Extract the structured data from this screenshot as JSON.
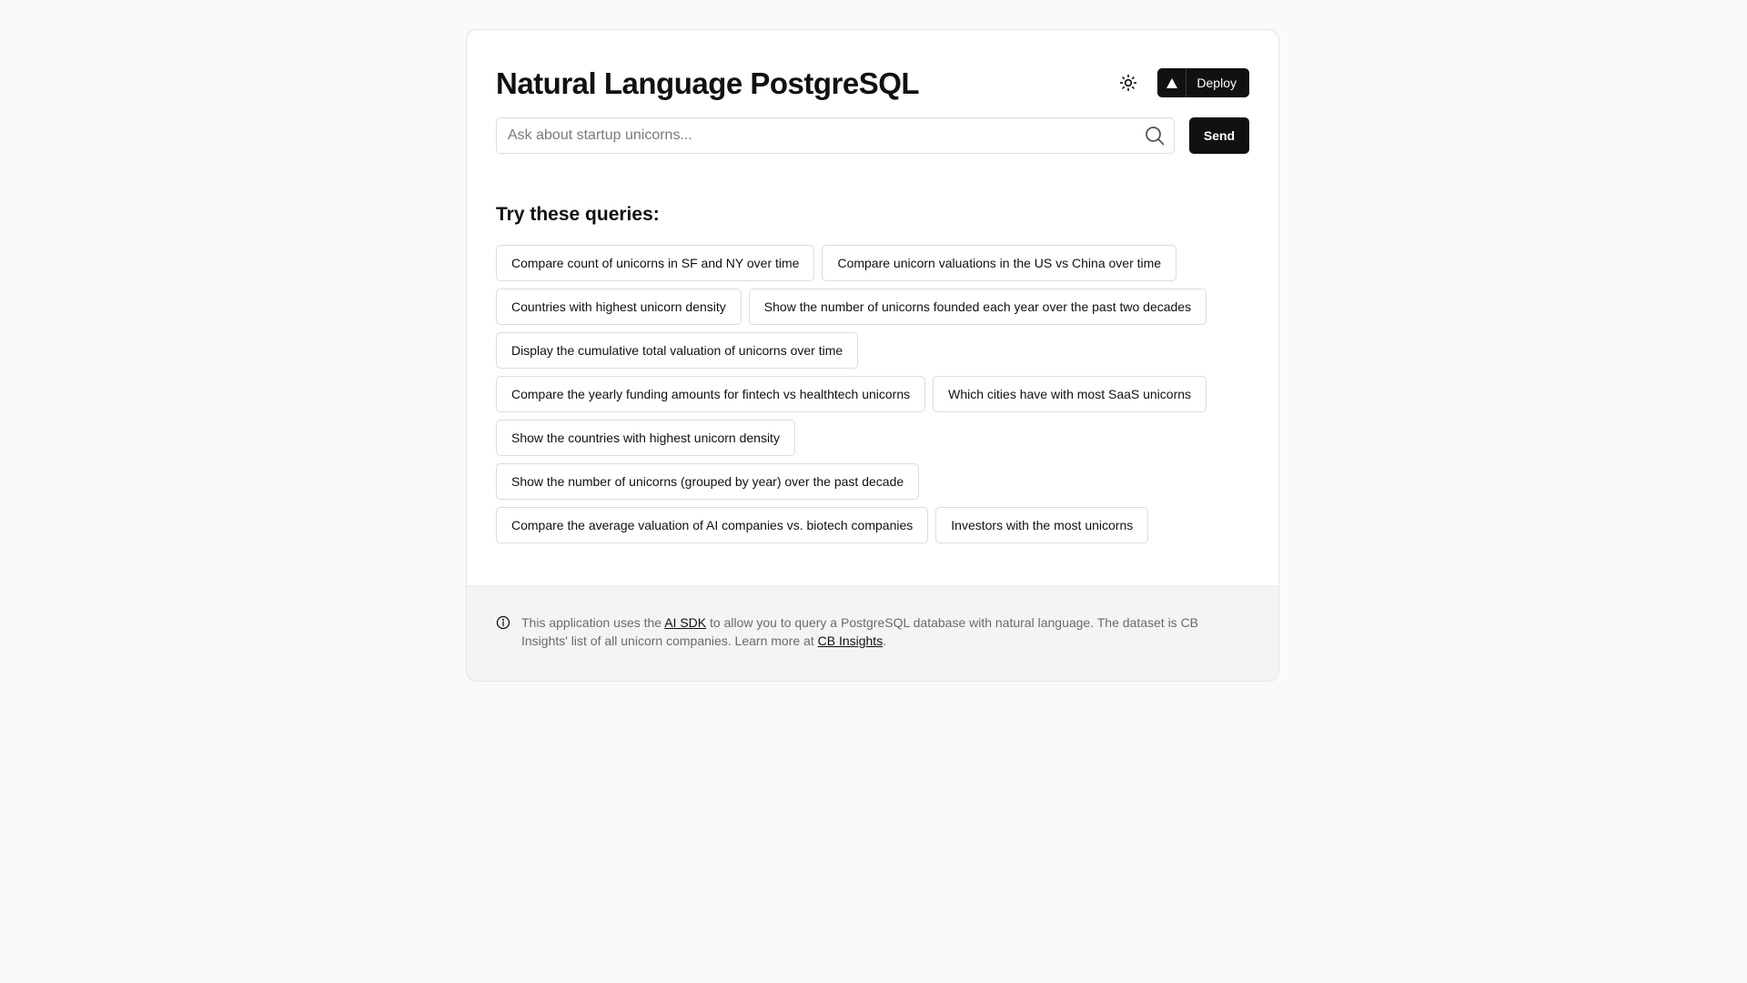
{
  "header": {
    "title": "Natural Language PostgreSQL",
    "theme_icon": "sun-icon",
    "deploy_icon": "triangle-icon",
    "deploy_label": "Deploy"
  },
  "search": {
    "placeholder": "Ask about startup unicorns...",
    "value": "",
    "icon": "search-icon",
    "send_label": "Send"
  },
  "suggestions": {
    "heading": "Try these queries:",
    "rows": [
      [
        "Compare count of unicorns in SF and NY over time",
        "Compare unicorn valuations in the US vs China over time"
      ],
      [
        "Countries with highest unicorn density",
        "Show the number of unicorns founded each year over the past two decades"
      ],
      [
        "Display the cumulative total valuation of unicorns over time"
      ],
      [
        "Compare the yearly funding amounts for fintech vs healthtech unicorns",
        "Which cities have with most SaaS unicorns"
      ],
      [
        "Show the countries with highest unicorn density"
      ],
      [
        "Show the number of unicorns (grouped by year) over the past decade"
      ],
      [
        "Compare the average valuation of AI companies vs. biotech companies",
        "Investors with the most unicorns"
      ]
    ]
  },
  "footer": {
    "icon": "info-icon",
    "text_before_ai_sdk": "This application uses the ",
    "ai_sdk_link": "AI SDK",
    "text_middle": " to allow you to query a PostgreSQL database with natural language. The dataset is CB Insights' list of all unicorn companies. Learn more at ",
    "cb_insights_link": "CB Insights",
    "text_end": "."
  },
  "colors": {
    "background": "#fafafa",
    "card": "#ffffff",
    "primary_button": "#111111",
    "border": "#dcdcdc",
    "footer_bg": "#f4f4f4",
    "muted_text": "#6b6b6b"
  }
}
